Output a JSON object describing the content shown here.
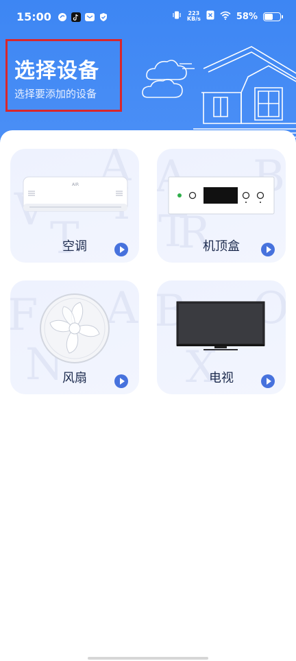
{
  "status_bar": {
    "time": "15:00",
    "net_speed_value": "223",
    "net_speed_unit": "KB/s",
    "battery_percent_text": "58%",
    "battery_level": 0.58,
    "icons": [
      "sync-icon",
      "tiktok-icon",
      "mail-icon",
      "shield-icon",
      "vibrate-icon",
      "no-sim-icon",
      "wifi-icon",
      "battery-icon"
    ]
  },
  "header": {
    "title": "选择设备",
    "subtitle": "选择要添加的设备",
    "background_color": "#4189f4",
    "highlight_color": "#d9262b"
  },
  "devices": [
    {
      "label": "空调",
      "icon": "air-conditioner-icon",
      "device_brand_text": "AIR",
      "bg_letters": [
        "A",
        "I",
        "T",
        "V"
      ]
    },
    {
      "label": "机顶盒",
      "icon": "set-top-box-icon",
      "bg_letters": [
        "A",
        "T",
        "R",
        "B"
      ]
    },
    {
      "label": "风扇",
      "icon": "fan-icon",
      "bg_letters": [
        "F",
        "A",
        "N"
      ]
    },
    {
      "label": "电视",
      "icon": "tv-icon",
      "bg_letters": [
        "B",
        "O",
        "X"
      ]
    }
  ],
  "accent_color": "#4772dd"
}
